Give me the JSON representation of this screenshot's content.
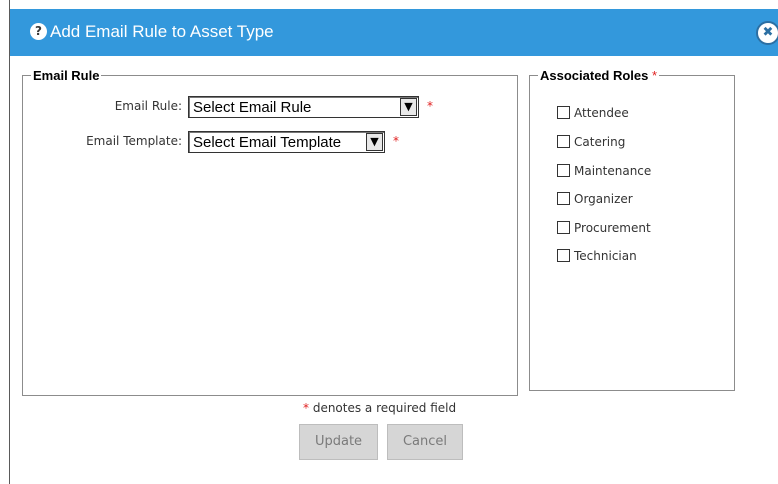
{
  "dialog": {
    "title": "Add Email Rule to Asset Type",
    "help_icon": "question-circle-icon",
    "close_icon": "close-circle-icon",
    "close_glyph": "✖"
  },
  "email_rule_group": {
    "legend": "Email Rule",
    "email_rule": {
      "label": "Email Rule:",
      "value": "Select Email Rule",
      "required_mark": "*"
    },
    "email_template": {
      "label": "Email Template:",
      "value": "Select Email Template",
      "required_mark": "*"
    }
  },
  "roles_group": {
    "legend": "Associated Roles",
    "required_mark": "*",
    "roles": [
      {
        "label": "Attendee",
        "checked": false
      },
      {
        "label": "Catering",
        "checked": false
      },
      {
        "label": "Maintenance",
        "checked": false
      },
      {
        "label": "Organizer",
        "checked": false
      },
      {
        "label": "Procurement",
        "checked": false
      },
      {
        "label": "Technician",
        "checked": false
      }
    ]
  },
  "footer": {
    "required_star": "*",
    "required_note": "denotes a required field",
    "update_label": "Update",
    "cancel_label": "Cancel"
  },
  "colors": {
    "titlebar": "#3398dc",
    "required": "#e02020",
    "button_bg": "#d6d6d6"
  }
}
